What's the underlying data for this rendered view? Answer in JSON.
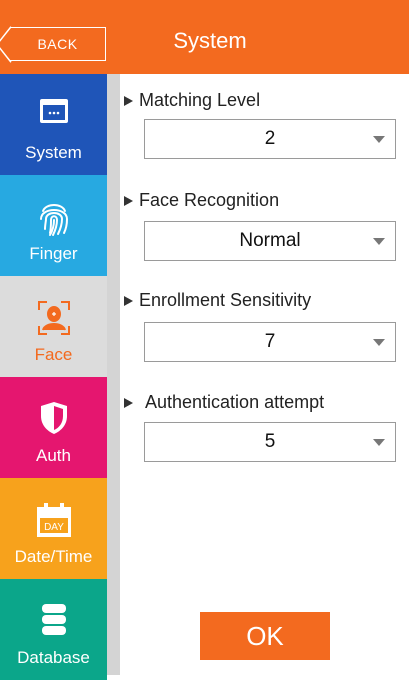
{
  "header": {
    "back_label": "BACK",
    "title": "System"
  },
  "sidebar": {
    "items": [
      {
        "label": "System",
        "color": "#1f55b8",
        "icon": "window-icon"
      },
      {
        "label": "Finger",
        "color": "#27a9e1",
        "icon": "fingerprint-icon"
      },
      {
        "label": "Face",
        "color": "#dcdcdc",
        "icon": "face-scan-icon",
        "active": true
      },
      {
        "label": "Auth",
        "color": "#e5166f",
        "icon": "shield-icon"
      },
      {
        "label": "Date/Time",
        "color": "#f7a21c",
        "icon": "calendar-icon"
      },
      {
        "label": "Database",
        "color": "#0ba68a",
        "icon": "database-icon"
      }
    ]
  },
  "settings": [
    {
      "label": "Matching Level",
      "value": "2"
    },
    {
      "label": "Face Recognition",
      "value": "Normal"
    },
    {
      "label": "Enrollment Sensitivity",
      "value": "7"
    },
    {
      "label": "Authentication attempt",
      "value": "5"
    }
  ],
  "calendar_text": "DAY",
  "ok_label": "OK",
  "colors": {
    "accent": "#f36a1f",
    "face_label": "#f36a1f"
  }
}
